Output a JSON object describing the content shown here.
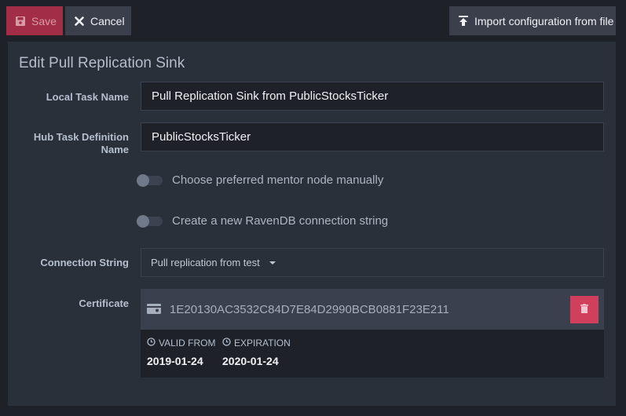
{
  "toolbar": {
    "save_label": "Save",
    "cancel_label": "Cancel",
    "import_label": "Import configuration from file"
  },
  "form": {
    "title": "Edit Pull Replication Sink",
    "local_task_name": {
      "label": "Local Task Name",
      "value": "Pull Replication Sink from PublicStocksTicker"
    },
    "hub_task_definition_name": {
      "label_line1": "Hub Task Definition",
      "label_line2": "Name",
      "value": "PublicStocksTicker"
    },
    "toggle_mentor": {
      "label": "Choose preferred mentor node manually",
      "on": false
    },
    "toggle_connection": {
      "label": "Create a new RavenDB connection string",
      "on": false
    },
    "connection_string": {
      "label": "Connection String",
      "selected": "Pull replication from test"
    },
    "certificate": {
      "label": "Certificate",
      "thumbprint": "1E20130AC3532C84D7E84D2990BCB0881F23E211",
      "valid_from_label": "VALID FROM",
      "valid_from": "2019-01-24",
      "expiration_label": "EXPIRATION",
      "expiration": "2020-01-24"
    }
  },
  "colors": {
    "save_bg": "#a12d46",
    "delete_bg": "#d0405d",
    "panel_bg": "#2a3039",
    "page_bg": "#1f2128"
  },
  "icons": [
    "save-icon",
    "close-icon",
    "upload-icon",
    "clock-icon",
    "certificate-icon",
    "trash-icon"
  ]
}
